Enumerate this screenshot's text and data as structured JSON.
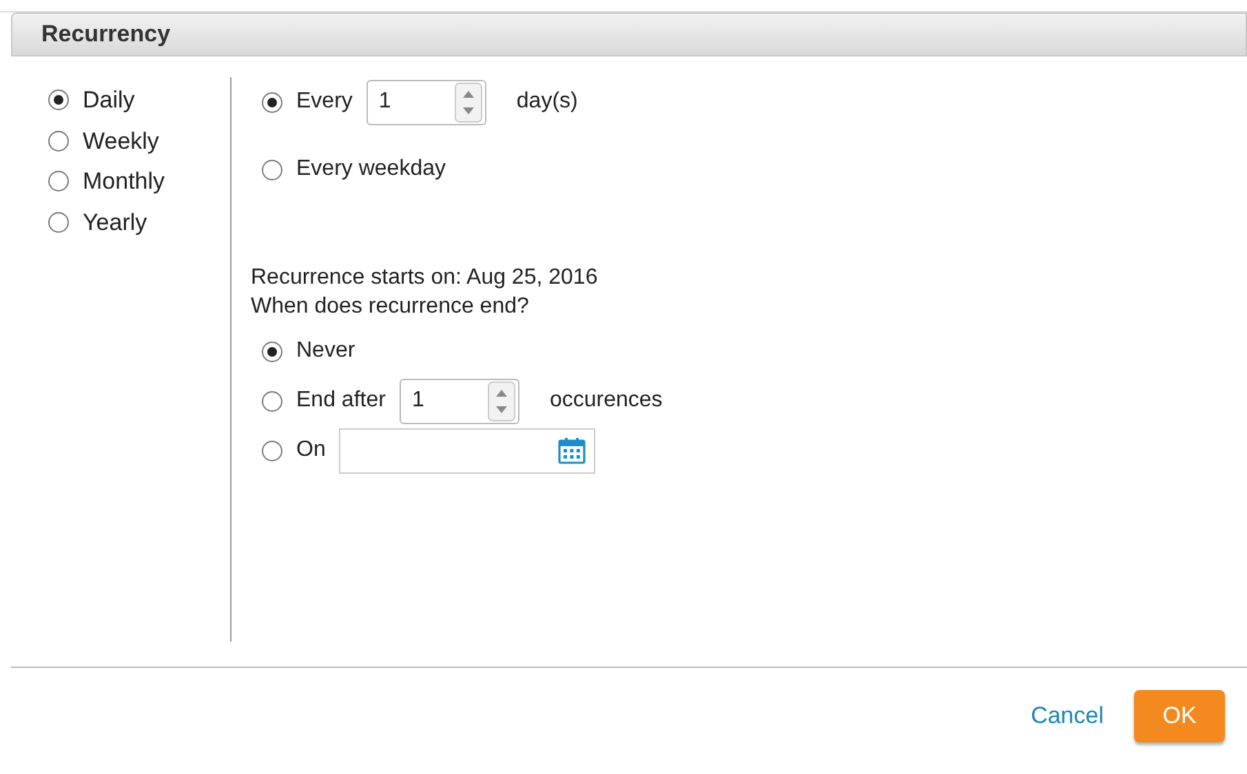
{
  "title": "Recurrency",
  "patterns": [
    {
      "label": "Daily",
      "selected": true
    },
    {
      "label": "Weekly",
      "selected": false
    },
    {
      "label": "Monthly",
      "selected": false
    },
    {
      "label": "Yearly",
      "selected": false
    }
  ],
  "daily_options": [
    {
      "kind": "spinner",
      "label": "Every",
      "value": "1",
      "suffix": "day(s)",
      "selected": true
    },
    {
      "kind": "plain",
      "label": "Every weekday",
      "selected": false
    }
  ],
  "starts_text": "Recurrence starts on: Aug 25, 2016",
  "end_question": "When does recurrence end?",
  "end_options": [
    {
      "kind": "plain",
      "label": "Never",
      "selected": true
    },
    {
      "kind": "spinner",
      "label": "End after",
      "value": "1",
      "suffix": "occurences",
      "selected": false
    },
    {
      "kind": "date",
      "label": "On",
      "selected": false
    }
  ],
  "buttons": {
    "cancel": "Cancel",
    "ok": "OK"
  }
}
